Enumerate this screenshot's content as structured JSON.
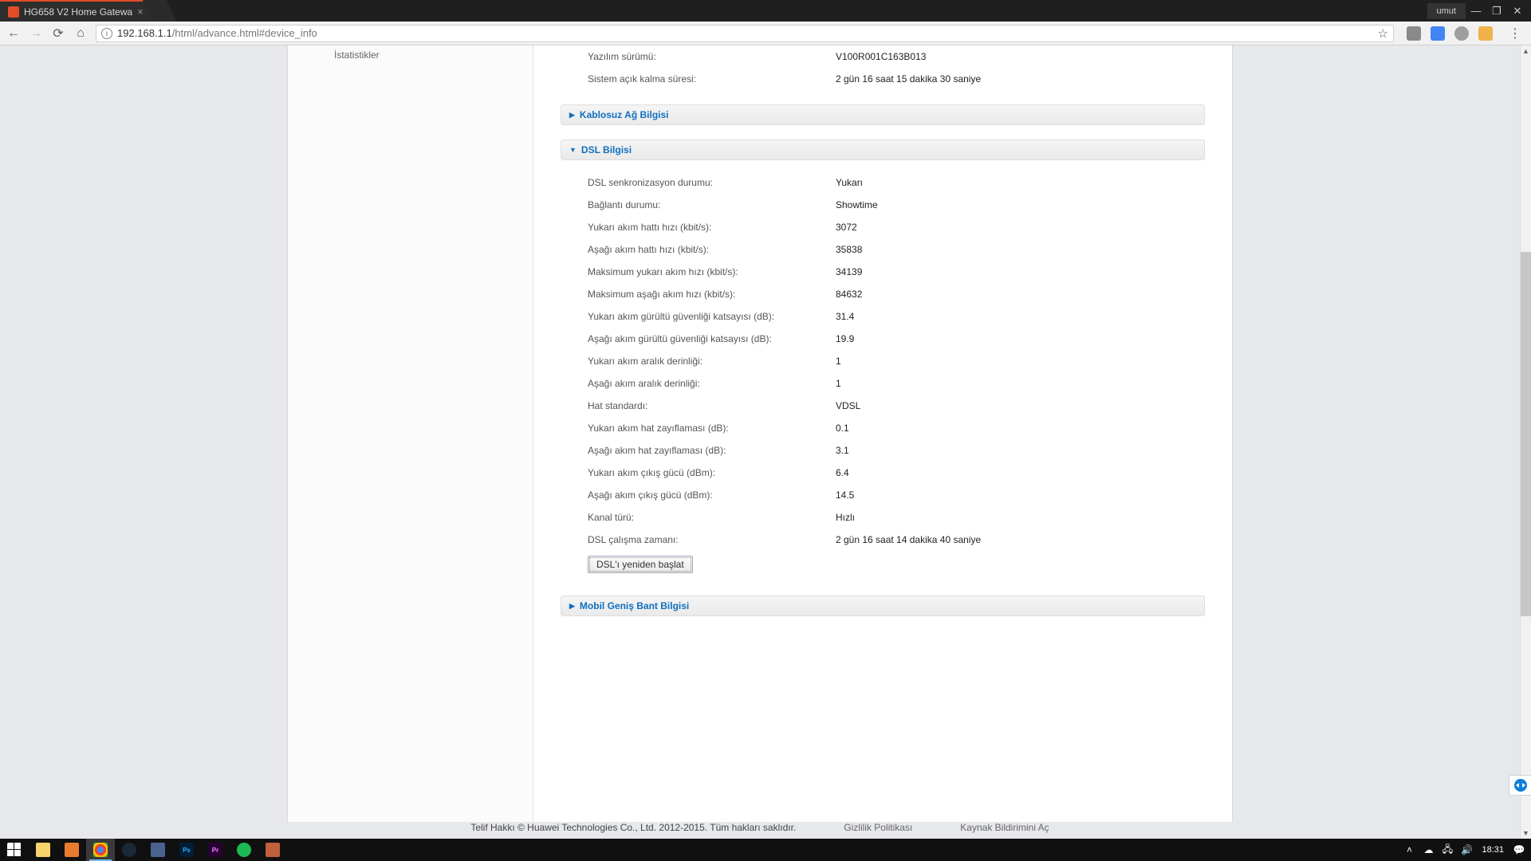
{
  "titlebar": {
    "tab_title": "HG658 V2 Home Gatewa",
    "user": "umut"
  },
  "address": {
    "url_host": "192.168.1.1",
    "url_path": "/html/advance.html#device_info"
  },
  "sidebar": {
    "item_stats": "İstatistikler"
  },
  "device_info": {
    "rows": [
      {
        "label": "Yazılım sürümü:",
        "value": "V100R001C163B013"
      },
      {
        "label": "Sistem açık kalma süresi:",
        "value": "2 gün 16 saat 15 dakika 30 saniye"
      }
    ]
  },
  "panels": {
    "wifi": "Kablosuz Ağ Bilgisi",
    "dsl": "DSL Bilgisi",
    "mobile": "Mobil Geniş Bant Bilgisi"
  },
  "dsl": {
    "rows": [
      {
        "label": "DSL senkronizasyon durumu:",
        "value": "Yukarı"
      },
      {
        "label": "Bağlantı durumu:",
        "value": "Showtime"
      },
      {
        "label": "Yukarı akım hattı hızı (kbit/s):",
        "value": "3072"
      },
      {
        "label": "Aşağı akım hattı hızı (kbit/s):",
        "value": "35838"
      },
      {
        "label": "Maksimum yukarı akım hızı (kbit/s):",
        "value": "34139"
      },
      {
        "label": "Maksimum aşağı akım hızı (kbit/s):",
        "value": "84632"
      },
      {
        "label": "Yukarı akım gürültü güvenliği katsayısı (dB):",
        "value": "31.4"
      },
      {
        "label": "Aşağı akım gürültü güvenliği katsayısı (dB):",
        "value": "19.9"
      },
      {
        "label": "Yukarı akım aralık derinliği:",
        "value": "1"
      },
      {
        "label": "Aşağı akım aralık derinliği:",
        "value": "1"
      },
      {
        "label": "Hat standardı:",
        "value": "VDSL"
      },
      {
        "label": "Yukarı akım hat zayıflaması (dB):",
        "value": "0.1"
      },
      {
        "label": "Aşağı akım hat zayıflaması (dB):",
        "value": "3.1"
      },
      {
        "label": "Yukarı akım çıkış gücü (dBm):",
        "value": "6.4"
      },
      {
        "label": "Aşağı akım çıkış gücü (dBm):",
        "value": "14.5"
      },
      {
        "label": "Kanal türü:",
        "value": "Hızlı"
      },
      {
        "label": "DSL çalışma zamanı:",
        "value": "2 gün 16 saat 14 dakika 40 saniye"
      }
    ],
    "restart_btn": "DSL'ı yeniden başlat"
  },
  "footer": {
    "copyright": "Telif Hakkı © Huawei Technologies Co., Ltd. 2012-2015. Tüm hakları saklıdır.",
    "privacy": "Gizlilik Politikası",
    "osn": "Kaynak Bildirimini Aç"
  },
  "taskbar": {
    "clock": "18:31"
  }
}
